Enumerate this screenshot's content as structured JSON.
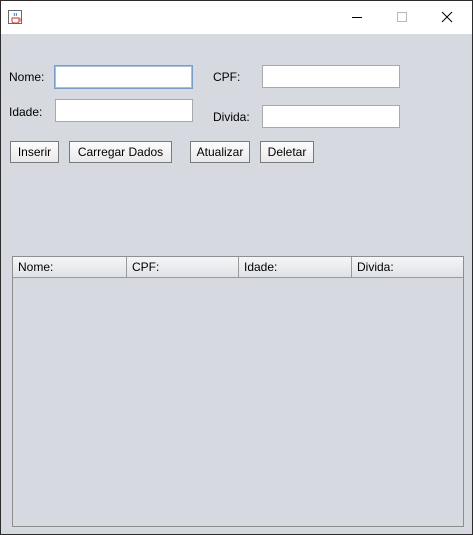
{
  "window": {
    "controls": {
      "minimize": "minimize-icon",
      "maximize": "maximize-icon",
      "close": "close-icon"
    },
    "app_icon": "java-cup-icon"
  },
  "form": {
    "nome_label": "Nome:",
    "nome_value": "",
    "cpf_label": "CPF:",
    "cpf_value": "",
    "idade_label": "Idade:",
    "idade_value": "",
    "divida_label": "Divida:",
    "divida_value": ""
  },
  "buttons": {
    "inserir": "Inserir",
    "carregar": "Carregar Dados",
    "atualizar": "Atualizar",
    "deletar": "Deletar"
  },
  "table": {
    "columns": [
      "Nome:",
      "CPF:",
      "Idade:",
      "Divida:"
    ],
    "rows": []
  },
  "colors": {
    "background": "#d6d9df",
    "focus_border": "#7a9cc6"
  }
}
